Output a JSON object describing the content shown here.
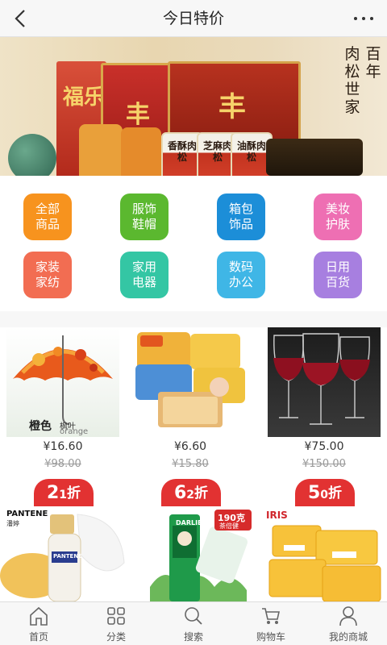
{
  "header": {
    "title": "今日特价",
    "back_icon": "chevron-left-icon",
    "more_icon": "more-dots-icon"
  },
  "banner": {
    "brand_lines": [
      "百年",
      "肉松世家"
    ],
    "jar_labels": [
      "香酥肉松",
      "芝麻肉松",
      "油酥肉松"
    ],
    "box_labels": [
      "福乐",
      "丰",
      "丰"
    ]
  },
  "categories": [
    {
      "label": "全部商品",
      "color": "#f7931e"
    },
    {
      "label": "服饰鞋帽",
      "color": "#5bb82f"
    },
    {
      "label": "箱包饰品",
      "color": "#1c8ed8"
    },
    {
      "label": "美妆护肤",
      "color": "#ee6fb3"
    },
    {
      "label": "家装家纺",
      "color": "#f26d52"
    },
    {
      "label": "家用电器",
      "color": "#34c6a4"
    },
    {
      "label": "数码办公",
      "color": "#3fb6e6"
    },
    {
      "label": "日用百货",
      "color": "#a77fe0"
    }
  ],
  "products": [
    {
      "name": "橙色枫叶雨伞",
      "image_caption": "橙色",
      "image_subcaption": "枫叶",
      "image_tag": "orange",
      "price": "¥16.60",
      "old_price": "¥98.00",
      "discount_main": "2",
      "discount_sub": "1",
      "discount_unit": "折"
    },
    {
      "name": "零食面包",
      "image_caption": "",
      "image_subcaption": "",
      "image_tag": "",
      "price": "¥6.60",
      "old_price": "¥15.80",
      "discount_main": "6",
      "discount_sub": "2",
      "discount_unit": "折"
    },
    {
      "name": "红酒杯",
      "image_caption": "",
      "image_subcaption": "",
      "image_tag": "",
      "price": "¥75.00",
      "old_price": "¥150.00",
      "discount_main": "5",
      "discount_sub": "0",
      "discount_unit": "折"
    }
  ],
  "products_row2": [
    {
      "brand": "PANTENE",
      "brand_cn": "潘婷",
      "bottle_label": "PANTENE"
    },
    {
      "brand": "DARLIE",
      "badge": "190克",
      "badge_sub": "茶倍健"
    },
    {
      "brand": "IRIS"
    }
  ],
  "bottom_nav": [
    {
      "label": "首页",
      "icon": "home-icon"
    },
    {
      "label": "分类",
      "icon": "grid-icon"
    },
    {
      "label": "搜索",
      "icon": "search-icon"
    },
    {
      "label": "购物车",
      "icon": "cart-icon"
    },
    {
      "label": "我的商城",
      "icon": "user-icon"
    }
  ],
  "colors": {
    "accent_red": "#e23232",
    "price_text": "#333333",
    "old_price": "#999999"
  }
}
